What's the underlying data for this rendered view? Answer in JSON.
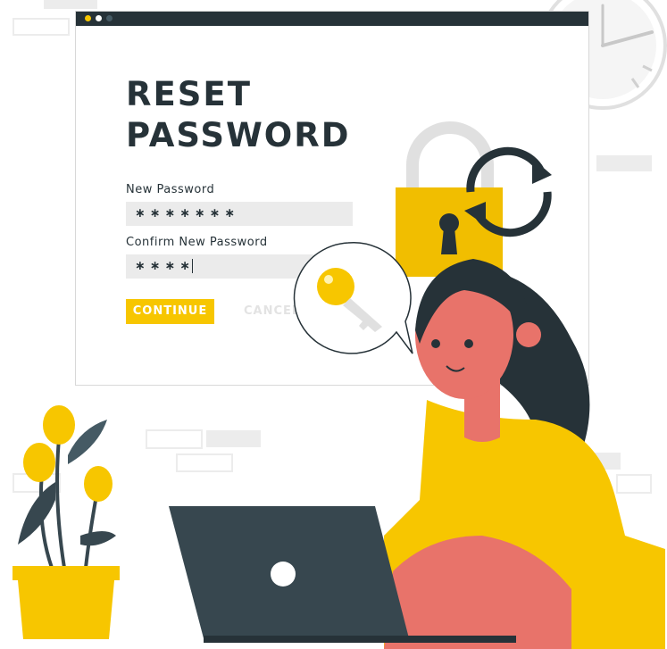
{
  "heading_line1": "RESET",
  "heading_line2": "PASSWORD",
  "new_password": {
    "label": "New Password",
    "value": "∗∗∗∗∗∗∗"
  },
  "confirm_password": {
    "label": "Confirm New Password",
    "value": "∗∗∗∗"
  },
  "buttons": {
    "continue": "CONTINUE",
    "cancel": "CANCEL"
  },
  "colors": {
    "accent": "#f7c600",
    "dark": "#263238",
    "skin": "#e8736a",
    "field_bg": "#ebebeb"
  },
  "icons": [
    "window-dots",
    "padlock-icon",
    "refresh-arrows-icon",
    "key-icon",
    "clock-icon"
  ]
}
